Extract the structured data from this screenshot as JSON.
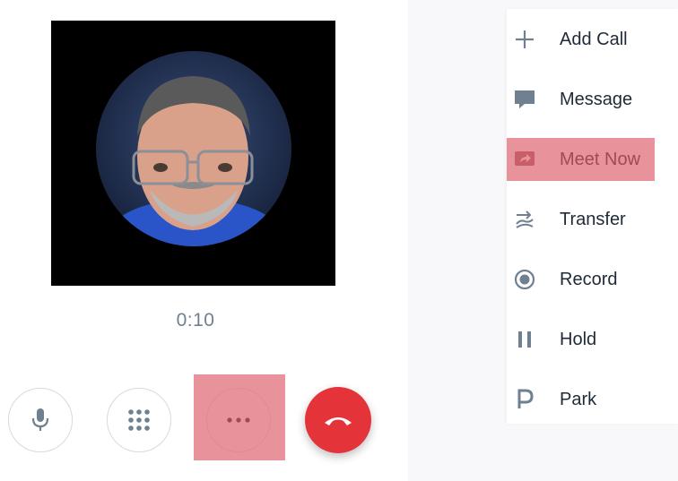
{
  "call": {
    "timer": "0:10"
  },
  "controls": {
    "mute_icon": "microphone-icon",
    "dialpad_icon": "dialpad-icon",
    "more_icon": "more-horizontal-icon",
    "hangup_icon": "hangup-icon"
  },
  "menu": {
    "items": [
      {
        "label": "Add Call",
        "icon": "plus-icon"
      },
      {
        "label": "Message",
        "icon": "chat-bubble-icon"
      },
      {
        "label": "Meet Now",
        "icon": "meet-now-icon"
      },
      {
        "label": "Transfer",
        "icon": "transfer-icon"
      },
      {
        "label": "Record",
        "icon": "record-icon"
      },
      {
        "label": "Hold",
        "icon": "pause-icon"
      },
      {
        "label": "Park",
        "icon": "park-icon"
      }
    ]
  },
  "colors": {
    "highlight": "#e8939b",
    "hangup": "#e4343a",
    "icon": "#6f8090",
    "text": "#1f2a36"
  }
}
